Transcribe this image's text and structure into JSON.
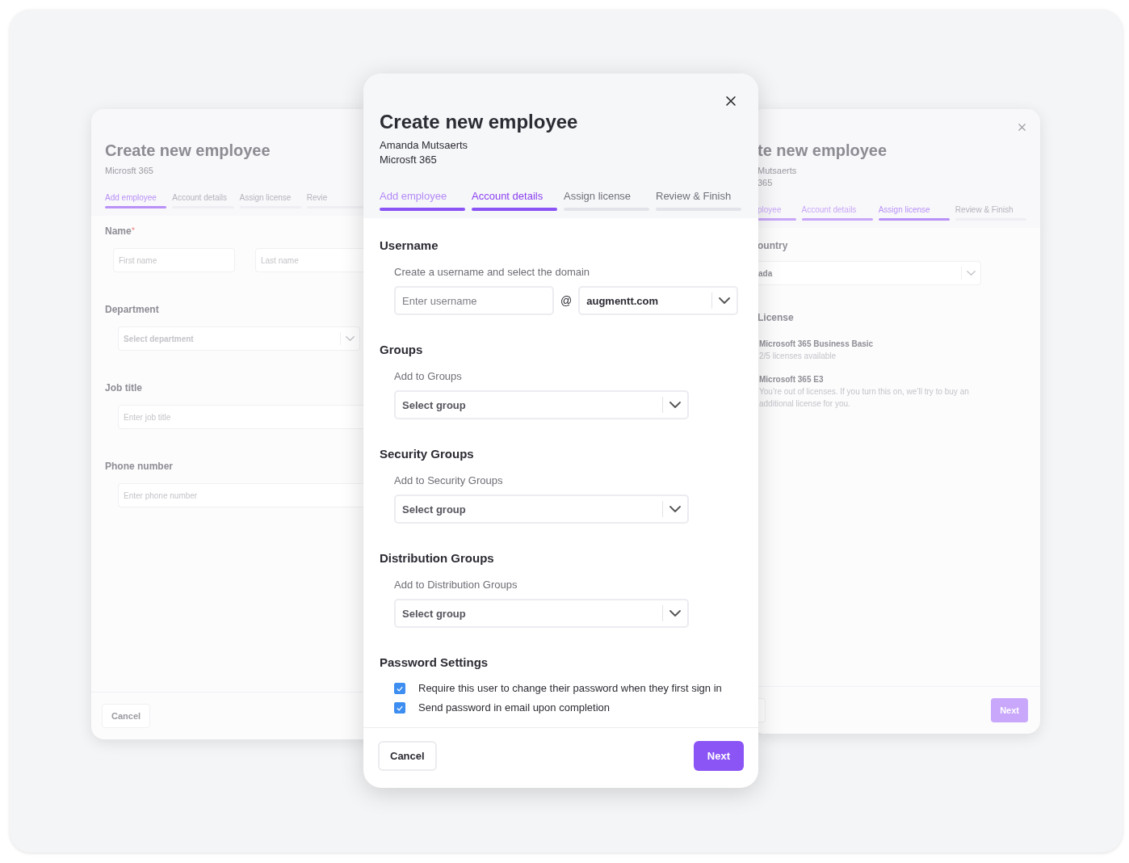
{
  "left_card": {
    "title": "Create new employee",
    "subtitle": "Microsft 365",
    "tabs": [
      {
        "label": "Add employee",
        "selected": true,
        "completed": false
      },
      {
        "label": "Account details",
        "selected": false,
        "completed": false
      },
      {
        "label": "Assign license",
        "selected": false,
        "completed": false
      },
      {
        "label": "Revie",
        "selected": false,
        "completed": false
      }
    ],
    "name": {
      "label": "Name",
      "required_mark": "*",
      "first_placeholder": "First name",
      "last_placeholder": "Last name"
    },
    "fields": [
      {
        "label": "Department",
        "kind": "select",
        "placeholder": "Select department"
      },
      {
        "label": "Job title",
        "kind": "text",
        "placeholder": "Enter job title"
      },
      {
        "label": "Phone number",
        "kind": "text",
        "placeholder": "Enter phone number"
      }
    ],
    "cancel": "Cancel"
  },
  "dialog": {
    "title": "Create new employee",
    "subtitle_lines": [
      "Amanda Mutsaerts",
      "Microsft 365"
    ],
    "tabs": [
      {
        "label": "Add employee",
        "selected": false,
        "completed": true
      },
      {
        "label": "Account details",
        "selected": true,
        "completed": false
      },
      {
        "label": "Assign license",
        "selected": false,
        "completed": false
      },
      {
        "label": "Review & Finish",
        "selected": false,
        "completed": false
      }
    ],
    "username": {
      "heading": "Username",
      "hint": "Create a username and select the domain",
      "placeholder": "Enter username",
      "at": "@",
      "domain": "augmentt.com"
    },
    "groups": [
      {
        "heading": "Groups",
        "hint": "Add to Groups",
        "placeholder": "Select group"
      },
      {
        "heading": "Security Groups",
        "hint": "Add to Security Groups",
        "placeholder": "Select group"
      },
      {
        "heading": "Distribution Groups",
        "hint": "Add to Distribution Groups",
        "placeholder": "Select group"
      }
    ],
    "password": {
      "heading": "Password Settings",
      "options": [
        {
          "label": "Require this user to change their password when they first sign in",
          "checked": true
        },
        {
          "label": "Send password in email upon completion",
          "checked": true
        }
      ]
    },
    "cancel": "Cancel",
    "next": "Next"
  },
  "right_card": {
    "title": "te new employee",
    "subtitle_lines": [
      "Mutsaerts",
      "365"
    ],
    "tabs": [
      {
        "label": "ployee",
        "selected": false,
        "completed": true
      },
      {
        "label": "Account details",
        "selected": false,
        "completed": true
      },
      {
        "label": "Assign license",
        "selected": true,
        "completed": false
      },
      {
        "label": "Review & Finish",
        "selected": false,
        "completed": false
      }
    ],
    "country": {
      "label": "ountry",
      "value": "ada"
    },
    "license_label": "License",
    "licenses": [
      {
        "name": "Microsoft 365 Business Basic",
        "note": "2/5 licenses available"
      },
      {
        "name": "Microsoft 365 E3",
        "note": "You’re out of licenses. If you turn this on, we’ll try to buy an additional license for you."
      }
    ],
    "next": "Next",
    "next_disabled": true
  }
}
